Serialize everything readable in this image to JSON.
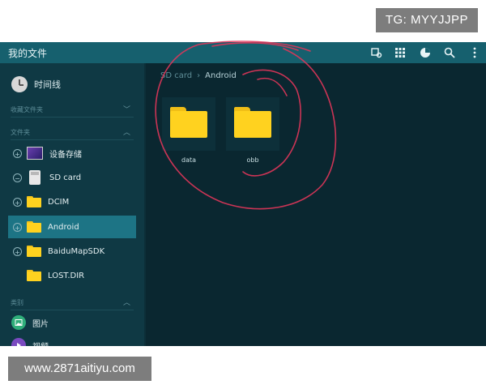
{
  "watermarks": {
    "top": "TG: MYYJJPP",
    "bottom": "www.2871aitiyu.com"
  },
  "app": {
    "title": "我的文件"
  },
  "toolbar": {
    "icons": [
      "search-folder-icon",
      "grid-view-icon",
      "storage-usage-icon",
      "search-icon",
      "more-icon"
    ]
  },
  "sidebar": {
    "history": {
      "label": "时间线"
    },
    "favorites": {
      "label": "收藏文件夹"
    },
    "folders": {
      "label": "文件夹"
    },
    "tree": [
      {
        "label": "设备存储",
        "expander": "+"
      },
      {
        "label": "SD card",
        "expander": "−"
      },
      {
        "label": "DCIM",
        "expander": "+"
      },
      {
        "label": "Android",
        "expander": "+",
        "selected": true
      },
      {
        "label": "BaiduMapSDK",
        "expander": "+"
      },
      {
        "label": "LOST.DIR",
        "expander": ""
      }
    ],
    "categories": {
      "label": "类别"
    },
    "category_items": [
      {
        "label": "图片"
      },
      {
        "label": "视频"
      }
    ]
  },
  "content": {
    "breadcrumb": {
      "root": "SD card",
      "separator": "›",
      "current": "Android"
    },
    "folders": [
      {
        "name": "data"
      },
      {
        "name": "obb"
      }
    ]
  },
  "colors": {
    "titlebar": "#16606e",
    "sidebar": "#0f3944",
    "content": "#0a2730",
    "selected_row": "#1d7485",
    "folder": "#ffd21f",
    "annotation": "#e0365a"
  }
}
